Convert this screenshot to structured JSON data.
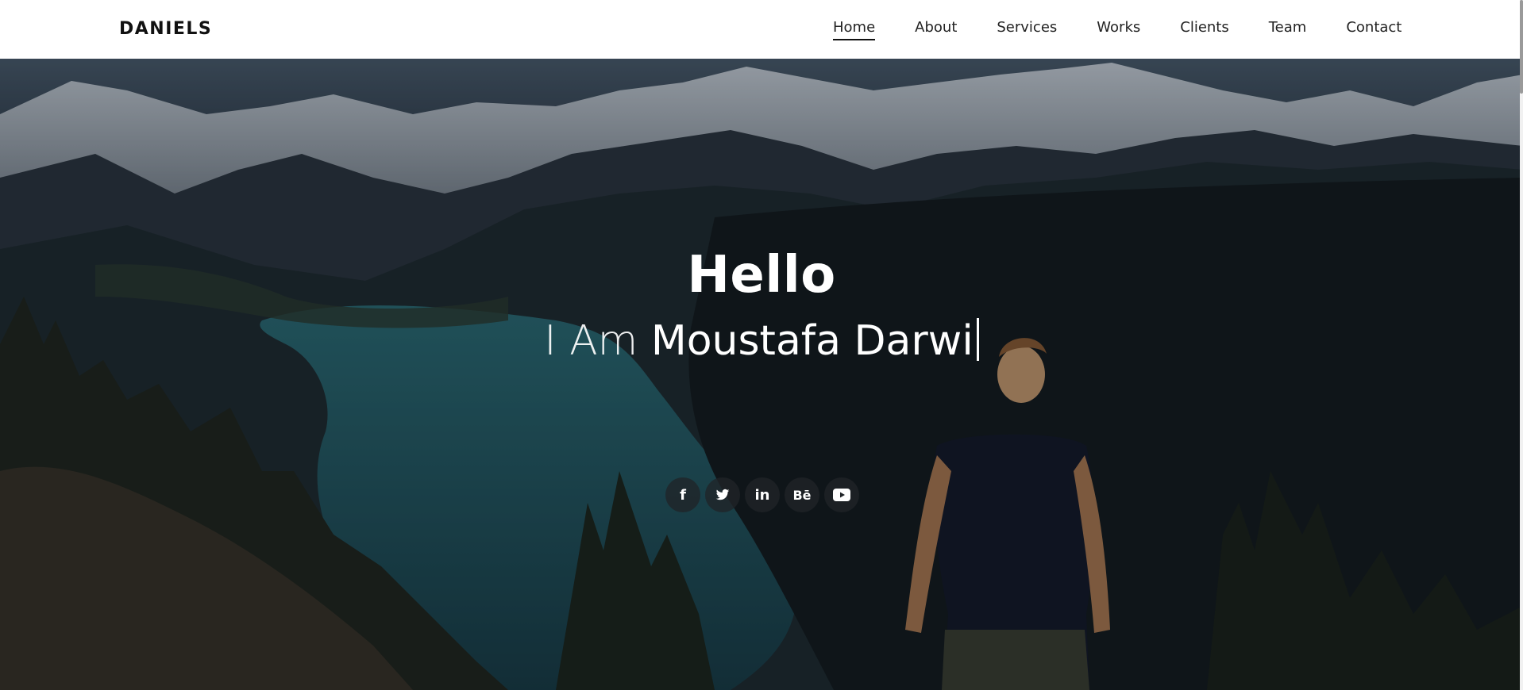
{
  "header": {
    "brand": "DANIELS",
    "nav": [
      {
        "label": "Home",
        "active": true
      },
      {
        "label": "About"
      },
      {
        "label": "Services"
      },
      {
        "label": "Works"
      },
      {
        "label": "Clients"
      },
      {
        "label": "Team"
      },
      {
        "label": "Contact"
      }
    ]
  },
  "hero": {
    "title": "Hello",
    "subtitle_prefix": "I Am",
    "subtitle_name": "Moustafa Darwi",
    "background_description_colors": {
      "sky": "#334452",
      "lake": "#1f5d66",
      "forest": "#141b1e"
    }
  },
  "socials": [
    {
      "name": "facebook-icon",
      "glyph": "f"
    },
    {
      "name": "twitter-icon",
      "glyph": ""
    },
    {
      "name": "linkedin-icon",
      "glyph": "in"
    },
    {
      "name": "behance-icon",
      "glyph": "Bē"
    },
    {
      "name": "youtube-icon",
      "glyph": ""
    }
  ],
  "colors": {
    "header_bg": "#ffffff",
    "text_dark": "#111111",
    "hero_text": "#ffffff"
  }
}
